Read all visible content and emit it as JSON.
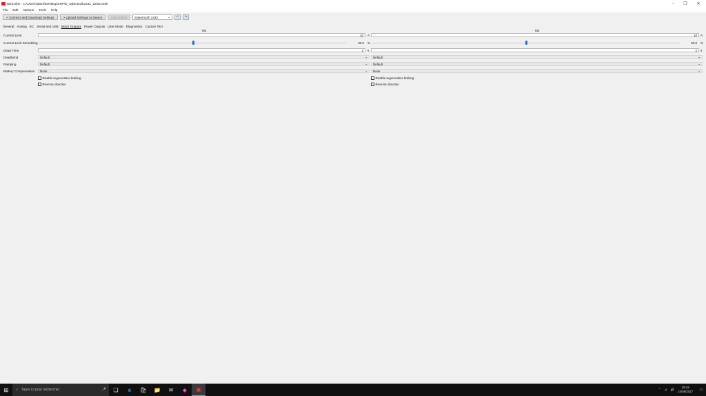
{
  "window": {
    "title": "DEScribe - C:\\Users\\Idaeri\\Desktop\\SRP\\D_sabertooth2x32_120w.tooth",
    "min_glyph": "–",
    "max_glyph": "❐",
    "close_glyph": "✕"
  },
  "menu": [
    "File",
    "Edit",
    "Options",
    "Tools",
    "Help"
  ],
  "toolbar": {
    "connect_label": "< Connect and Download Settings",
    "upload_label": "> Upload Settings to Device",
    "disabled_label": "Disconnect",
    "device_value": "Sabertooth 2x32",
    "combo_arrow": "⌄",
    "undo_glyph": "↶",
    "redo_glyph": "↷"
  },
  "tabs": [
    "General",
    "Analog",
    "RC",
    "Serial and USB",
    "Motor Outputs",
    "Power Outputs",
    "User Mode",
    "Diagnostics",
    "Custom Text"
  ],
  "active_tab": "Motor Outputs",
  "columns": {
    "m1": "M1",
    "m2": "M2"
  },
  "rows": {
    "current_limit": {
      "label": "Current Limit",
      "m1": "10",
      "m2": "10",
      "unit": "A"
    },
    "current_smoothing": {
      "label": "Current Limit Smoothing",
      "m1": "50.0",
      "m2": "50.0",
      "unit": "%",
      "fraction": 0.5
    },
    "dead_time": {
      "label": "Dead Time",
      "m1": "2",
      "m2": "2",
      "unit_m1": "s",
      "unit_m2": "s"
    },
    "deadband": {
      "label": "Deadband",
      "m1": "Default",
      "m2": "Default"
    },
    "ramping": {
      "label": "Ramping",
      "m1": "Default",
      "m2": "Default"
    },
    "battery_comp": {
      "label": "Battery Compensation",
      "m1": "None",
      "m2": "None"
    }
  },
  "checks": {
    "regen": "Disable regenerative braking",
    "reverse": "Reverse direction"
  },
  "drop_arrow": "⌄",
  "taskbar": {
    "start_glyph": "⊞",
    "search_glyph": "○",
    "search_placeholder": "Taper ici pour rechercher",
    "mic_glyph": "🎤",
    "icons": {
      "taskview": "❏",
      "edge": "e",
      "store": "🛍",
      "folder": "📁",
      "mail": "✉",
      "chrome": "◆",
      "describe": "▣"
    },
    "tray_up": "⌃",
    "tray_net": "⊿",
    "tray_vol": "🔊",
    "time": "18:42",
    "date": "24/09/2017",
    "notify_glyph": "🗨"
  }
}
